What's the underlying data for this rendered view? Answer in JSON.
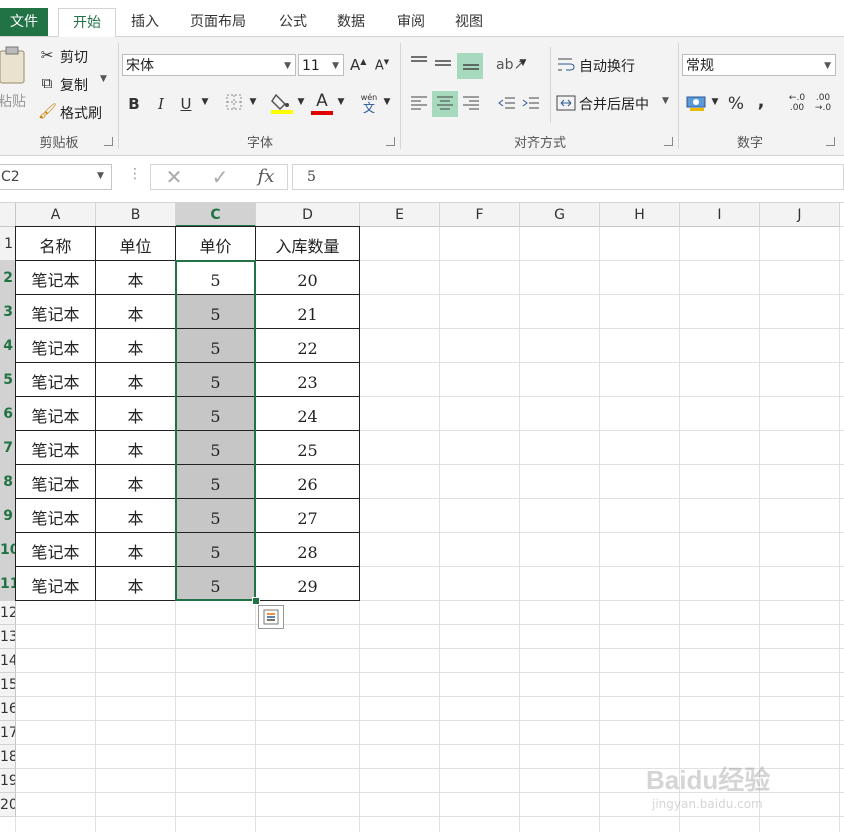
{
  "tabs": {
    "file": "文件",
    "items": [
      "开始",
      "插入",
      "页面布局",
      "公式",
      "数据",
      "审阅",
      "视图"
    ]
  },
  "clipboard": {
    "paste": "粘贴",
    "cut": "剪切",
    "copy": "复制",
    "format_painter": "格式刷",
    "label": "剪贴板"
  },
  "font": {
    "name": "宋体",
    "size": "11",
    "label": "字体",
    "bold": "B",
    "italic": "I",
    "underline": "U",
    "grow": "A",
    "shrink": "A",
    "font_color": "A",
    "phonetic": "wén"
  },
  "alignment": {
    "wrap": "自动换行",
    "merge": "合并后居中",
    "label": "对齐方式"
  },
  "number": {
    "format": "常规",
    "percent": "%",
    "comma": ",",
    "label": "数字"
  },
  "formula_bar": {
    "name_box": "C2",
    "fx": "fx",
    "value": "5"
  },
  "sheet": {
    "columns": [
      "A",
      "B",
      "C",
      "D",
      "E",
      "F",
      "G",
      "H",
      "I",
      "J"
    ],
    "selected_column": "C",
    "rows": [
      "1",
      "2",
      "3",
      "4",
      "5",
      "6",
      "7",
      "8",
      "9",
      "10",
      "11",
      "12",
      "13",
      "14",
      "15",
      "16",
      "17",
      "18",
      "19",
      "20"
    ],
    "header": [
      "名称",
      "单位",
      "单价",
      "入库数量"
    ],
    "data": [
      [
        "笔记本",
        "本",
        "5",
        "20"
      ],
      [
        "笔记本",
        "本",
        "5",
        "21"
      ],
      [
        "笔记本",
        "本",
        "5",
        "22"
      ],
      [
        "笔记本",
        "本",
        "5",
        "23"
      ],
      [
        "笔记本",
        "本",
        "5",
        "24"
      ],
      [
        "笔记本",
        "本",
        "5",
        "25"
      ],
      [
        "笔记本",
        "本",
        "5",
        "26"
      ],
      [
        "笔记本",
        "本",
        "5",
        "27"
      ],
      [
        "笔记本",
        "本",
        "5",
        "28"
      ],
      [
        "笔记本",
        "本",
        "5",
        "29"
      ]
    ]
  },
  "watermark": {
    "brand": "Baidu经验",
    "url": "jingyan.baidu.com"
  },
  "colors": {
    "accent": "#217346",
    "selection": "#c6c6c6",
    "highlight": "#a7d9bf"
  }
}
